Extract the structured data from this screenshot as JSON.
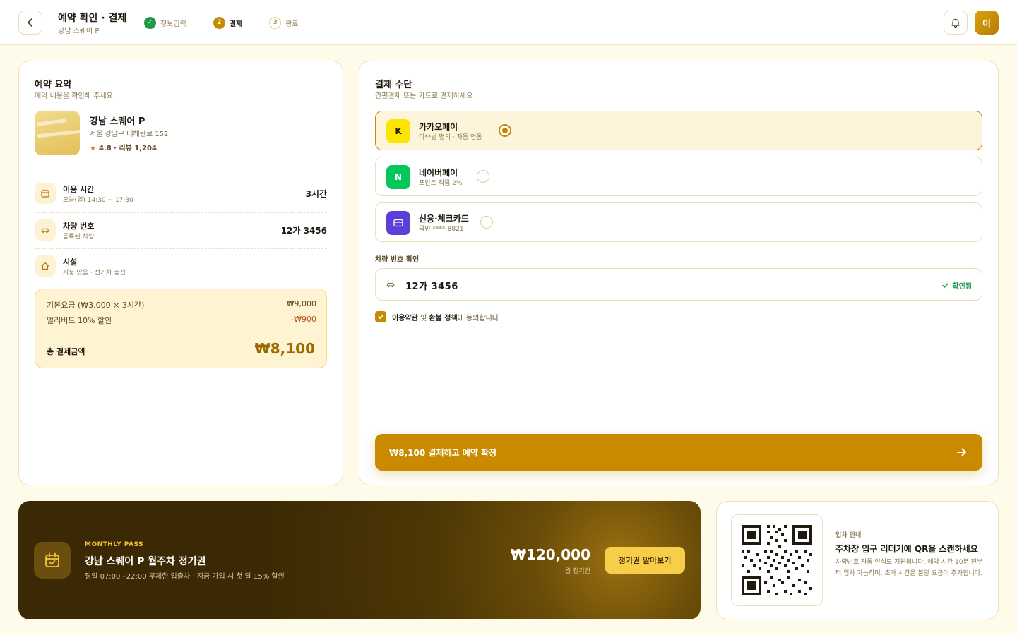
{
  "header": {
    "title": "예약 확인 · 결제",
    "subtitle": "강남 스퀘어 P",
    "steps": [
      {
        "label": "정보입력",
        "badge": "✓"
      },
      {
        "label": "결제",
        "badge": "2"
      },
      {
        "label": "완료",
        "badge": "3"
      }
    ],
    "avatar": "이"
  },
  "summary": {
    "title": "예약 요약",
    "subtitle": "예약 내용을 확인해 주세요",
    "place": {
      "name": "강남 스퀘어 P",
      "address": "서울 강남구 테헤란로 152",
      "rating": "4.8 · 리뷰 1,204"
    },
    "rows": [
      {
        "label": "이용 시간",
        "sub": "오늘(일) 14:30 ~ 17:30",
        "value": "3시간",
        "icon": "calendar-icon"
      },
      {
        "label": "차량 번호",
        "sub": "등록된 차량",
        "value": "12가 3456",
        "icon": "car-icon"
      },
      {
        "label": "시설",
        "sub": "지붕 있음 · 전기차 충전",
        "value": "",
        "icon": "home-icon"
      }
    ],
    "price": {
      "base_label": "기본요금 (₩3,000 × 3시간)",
      "base_value": "₩9,000",
      "discount_label": "얼리버드 10% 할인",
      "discount_value": "-₩900",
      "total_label": "총 결제금액",
      "total_value": "₩8,100"
    }
  },
  "payment": {
    "title": "결제 수단",
    "subtitle": "간편결제 또는 카드로 결제하세요",
    "methods": [
      {
        "logo": "K",
        "name": "카카오페이",
        "sub": "이**님 명의 · 자동 연동",
        "selected": true,
        "color": "#fee500"
      },
      {
        "logo": "N",
        "name": "네이버페이",
        "sub": "포인트 적립 2%",
        "selected": false,
        "color": "#03c75a"
      },
      {
        "logo": "",
        "name": "신용·체크카드",
        "sub": "국민 ****-8821",
        "selected": false,
        "color": "#5b3fd6"
      }
    ],
    "plate_label": "차량 번호 확인",
    "plate_value": "12가 3456",
    "plate_status": "확인됨",
    "agree_terms": "이용약관",
    "agree_and": " 및 ",
    "agree_refund": "환불 정책",
    "agree_tail": "에 동의합니다",
    "pay_button": "₩8,100 결제하고 예약 확정"
  },
  "banner": {
    "tag": "MONTHLY PASS",
    "title": "강남 스퀘어 P 월주차 정기권",
    "desc": "평일 07:00~22:00 무제한 입출차 · 지금 가입 시 첫 달 15% 할인",
    "price": "₩120,000",
    "price_sub": "월 정기권",
    "button": "정기권 알아보기"
  },
  "qr": {
    "tag": "입차 안내",
    "title": "주차장 입구 리더기에 QR을 스캔하세요",
    "desc": "차량번호 자동 인식도 지원됩니다. 예약 시간 10분 전부터 입차 가능하며, 초과 시간은 분당 요금이 추가됩니다."
  },
  "colors": {
    "accent": "#c98a00",
    "success": "#1d9a4a",
    "background": "#fffbea"
  }
}
